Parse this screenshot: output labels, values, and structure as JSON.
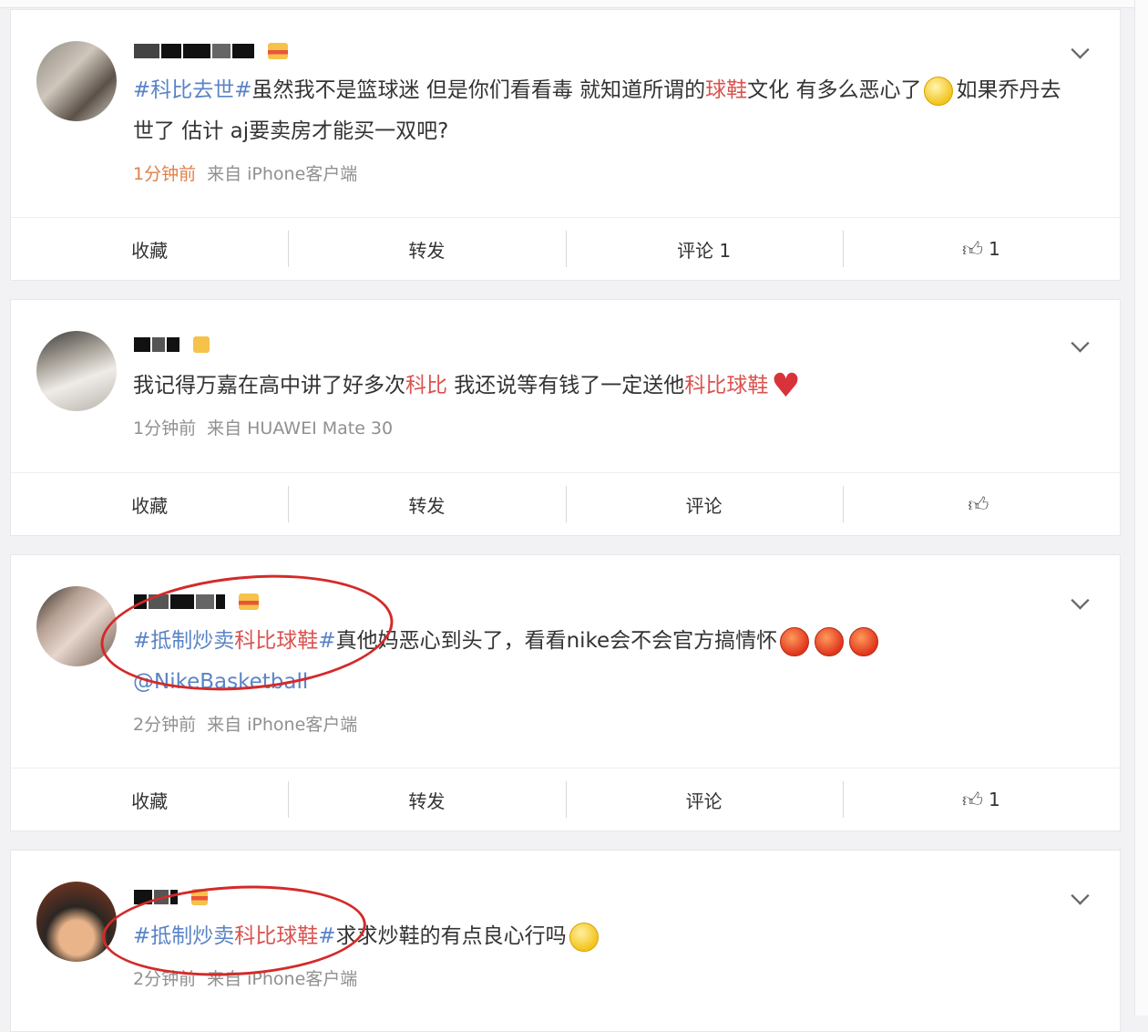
{
  "posts": [
    {
      "segments": [
        {
          "t": "#科比去世#",
          "c": "topic"
        },
        {
          "t": "虽然我不是篮球迷 但是你们看看毒 就知道所谓的",
          "c": ""
        },
        {
          "t": "球鞋",
          "c": "kw"
        },
        {
          "t": "文化 有多么恶心了",
          "c": ""
        }
      ],
      "segments2": [
        {
          "t": "如果乔丹去世了 估计 aj要卖房才能买一双吧?",
          "c": ""
        }
      ],
      "time": "1分钟前",
      "source": "来自 iPhone客户端",
      "collect": "收藏",
      "repost": "转发",
      "comment": "评论 1",
      "like": "1"
    },
    {
      "segments": [
        {
          "t": "我记得万嘉在高中讲了好多次",
          "c": ""
        },
        {
          "t": "科比",
          "c": "kw"
        },
        {
          "t": " 我还说等有钱了一定送他",
          "c": ""
        },
        {
          "t": "科比球鞋",
          "c": "kw"
        }
      ],
      "time": "1分钟前",
      "source": "来自 HUAWEI Mate 30",
      "collect": "收藏",
      "repost": "转发",
      "comment": "评论",
      "like": ""
    },
    {
      "segments": [
        {
          "t": "#抵制炒卖",
          "c": "topic"
        },
        {
          "t": "科比球鞋",
          "c": "kw"
        },
        {
          "t": "#",
          "c": "topic"
        },
        {
          "t": "真他妈恶心到头了，看看nike会不会官方搞情怀",
          "c": ""
        }
      ],
      "mention": "@NikeBasketball",
      "time": "2分钟前",
      "source": "来自 iPhone客户端",
      "collect": "收藏",
      "repost": "转发",
      "comment": "评论",
      "like": "1"
    },
    {
      "segments": [
        {
          "t": "#抵制炒卖",
          "c": "topic"
        },
        {
          "t": "科比球鞋",
          "c": "kw"
        },
        {
          "t": "#",
          "c": "topic"
        },
        {
          "t": "求求炒鞋的有点良心行吗",
          "c": ""
        }
      ],
      "time": "2分钟前",
      "source": "来自 iPhone客户端"
    }
  ],
  "icons": {
    "more": "chevron-down-icon",
    "like": "thumbs-up-icon"
  },
  "colors": {
    "topic": "#5a84c7",
    "keyword": "#d9534f",
    "annotation": "#d42a2a"
  }
}
